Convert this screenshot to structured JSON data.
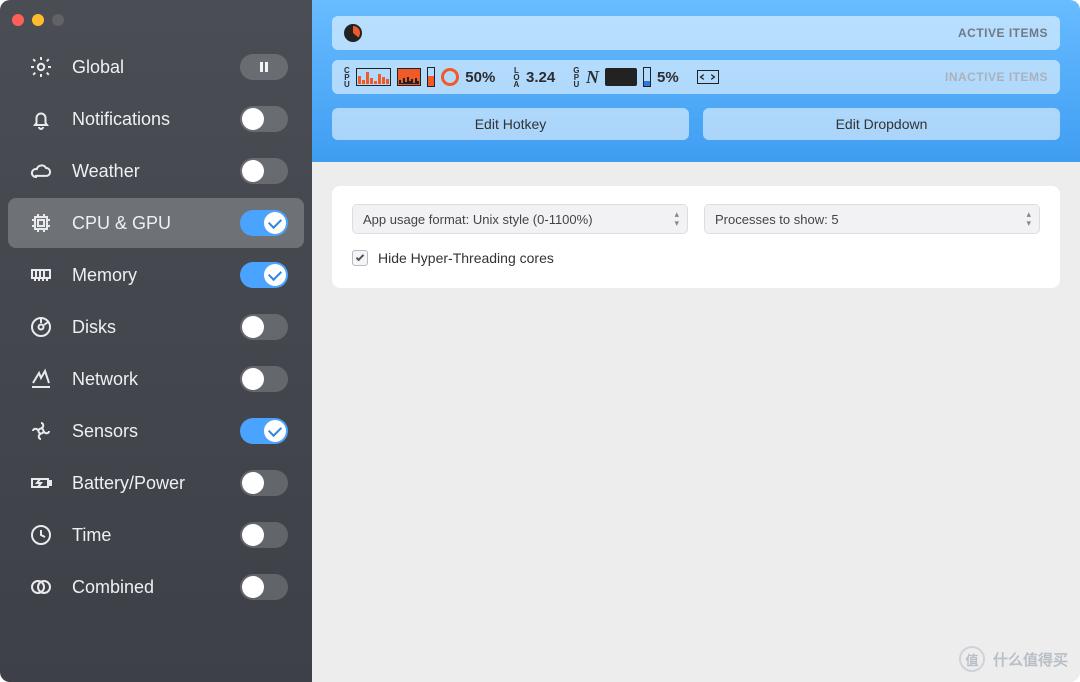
{
  "sidebar": {
    "items": [
      {
        "icon": "gear",
        "label": "Global",
        "kind": "pause"
      },
      {
        "icon": "bell",
        "label": "Notifications",
        "on": false
      },
      {
        "icon": "cloud",
        "label": "Weather",
        "on": false
      },
      {
        "icon": "chip",
        "label": "CPU & GPU",
        "on": true,
        "selected": true
      },
      {
        "icon": "memory",
        "label": "Memory",
        "on": true
      },
      {
        "icon": "disk",
        "label": "Disks",
        "on": false
      },
      {
        "icon": "network",
        "label": "Network",
        "on": false
      },
      {
        "icon": "fan",
        "label": "Sensors",
        "on": true
      },
      {
        "icon": "battery",
        "label": "Battery/Power",
        "on": false
      },
      {
        "icon": "clock",
        "label": "Time",
        "on": false
      },
      {
        "icon": "rings",
        "label": "Combined",
        "on": false
      }
    ]
  },
  "header": {
    "active_label": "ACTIVE ITEMS",
    "inactive_label": "INACTIVE ITEMS",
    "cpu_pct": "50%",
    "load_value": "3.24",
    "gpu_pct": "5%",
    "edit_hotkey": "Edit Hotkey",
    "edit_dropdown": "Edit Dropdown"
  },
  "panel": {
    "format_select": "App usage format: Unix style (0-1100%)",
    "processes_select": "Processes to show: 5",
    "hide_ht_label": "Hide Hyper-Threading cores",
    "hide_ht_checked": true
  },
  "watermark": {
    "badge": "值",
    "text": "什么值得买"
  }
}
